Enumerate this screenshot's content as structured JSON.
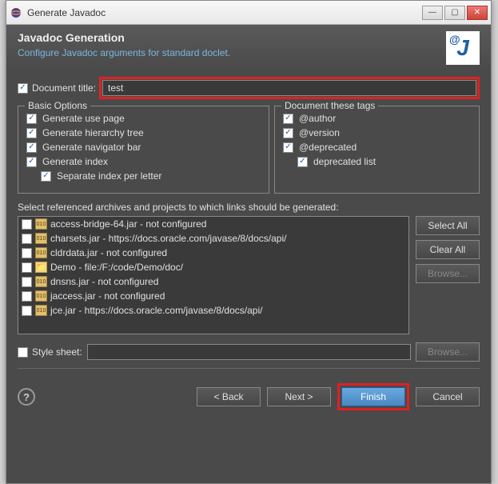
{
  "window": {
    "title": "Generate Javadoc"
  },
  "header": {
    "title": "Javadoc Generation",
    "subtitle": "Configure Javadoc arguments for standard doclet."
  },
  "doc_title": {
    "label": "Document title:",
    "value": "test"
  },
  "basic_options": {
    "legend": "Basic Options",
    "use_page": "Generate use page",
    "hierarchy": "Generate hierarchy tree",
    "navigator": "Generate navigator bar",
    "index": "Generate index",
    "separate": "Separate index per letter"
  },
  "tags": {
    "legend": "Document these tags",
    "author": "@author",
    "version": "@version",
    "deprecated": "@deprecated",
    "deprecated_list": "deprecated list"
  },
  "archives": {
    "label": "Select referenced archives and projects to which links should be generated:",
    "items": [
      {
        "name": "access-bridge-64.jar - not configured",
        "type": "jar"
      },
      {
        "name": "charsets.jar - https://docs.oracle.com/javase/8/docs/api/",
        "type": "jar"
      },
      {
        "name": "cldrdata.jar - not configured",
        "type": "jar"
      },
      {
        "name": "Demo - file:/F:/code/Demo/doc/",
        "type": "folder"
      },
      {
        "name": "dnsns.jar - not configured",
        "type": "jar"
      },
      {
        "name": "jaccess.jar - not configured",
        "type": "jar"
      },
      {
        "name": "jce.jar - https://docs.oracle.com/javase/8/docs/api/",
        "type": "jar"
      }
    ]
  },
  "buttons": {
    "select_all": "Select All",
    "clear_all": "Clear All",
    "browse": "Browse...",
    "back": "< Back",
    "next": "Next >",
    "finish": "Finish",
    "cancel": "Cancel"
  },
  "stylesheet": {
    "label": "Style sheet:",
    "value": ""
  }
}
